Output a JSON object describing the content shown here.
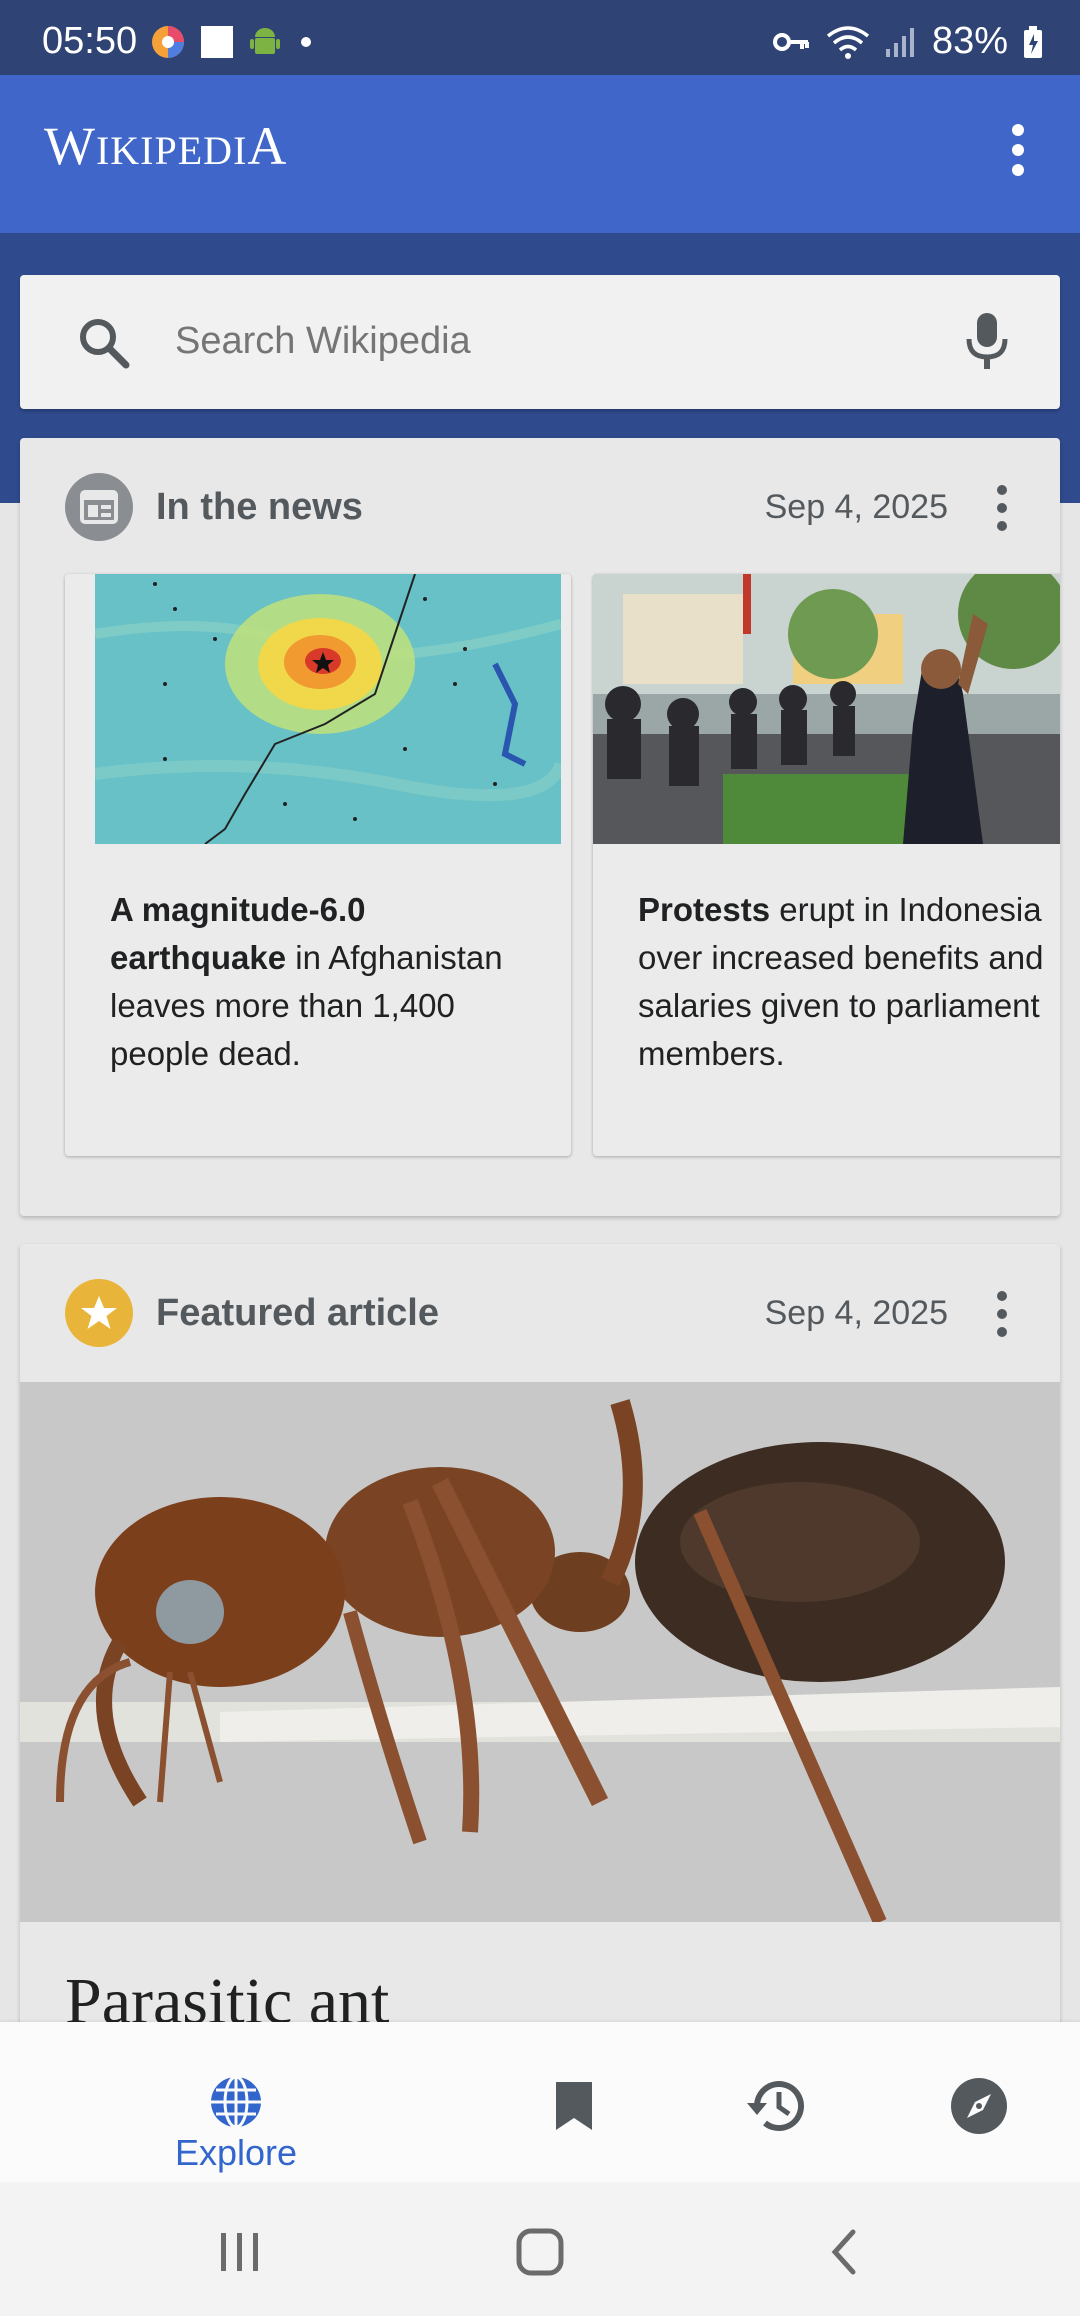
{
  "status_bar": {
    "time": "05:50",
    "battery": "83%"
  },
  "app_bar": {
    "title_w": "W",
    "title_ikipedi": "IKIPEDI",
    "title_a": "A"
  },
  "search": {
    "placeholder": "Search Wikipedia"
  },
  "news_card": {
    "title": "In the news",
    "date": "Sep 4, 2025",
    "items": [
      {
        "bold": "A magnitude-6.0 earthquake",
        "text": " in Afghanistan leaves more than 1,400 people dead."
      },
      {
        "bold": "Protests",
        "text": " erupt in Indonesia over increased benefits and salaries given to parliament members."
      }
    ]
  },
  "featured_card": {
    "title": "Featured article",
    "date": "Sep 4, 2025",
    "article_title": "Parasitic ant"
  },
  "bottom_nav": {
    "explore_label": "Explore"
  },
  "icons": {
    "search": "search-icon",
    "mic": "microphone-icon",
    "news": "newspaper-icon",
    "featured": "star-icon",
    "explore": "globe-icon",
    "saved": "bookmark-icon",
    "history": "history-icon",
    "nearby": "compass-icon"
  },
  "colors": {
    "status_bar": "#2f4374",
    "app_bar": "#3f66c8",
    "accent": "#3366cc",
    "star_badge": "#e8b53a"
  }
}
